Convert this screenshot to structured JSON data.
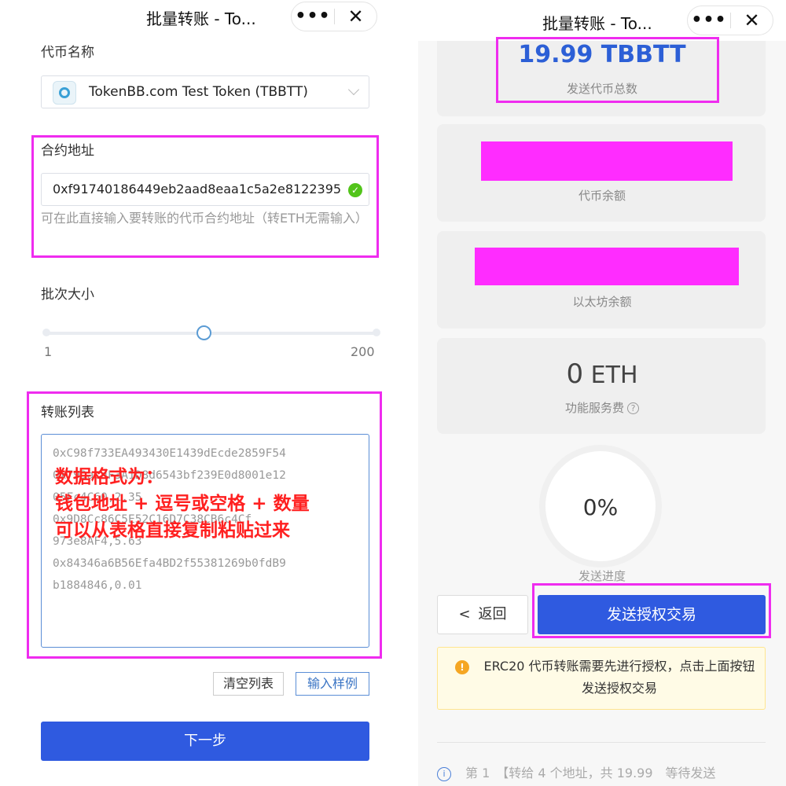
{
  "left": {
    "title": "批量转账 - To...",
    "capsule": {
      "more": "•••",
      "close": "✕"
    },
    "token_name_label": "代币名称",
    "token_select_value": "TokenBB.com Test Token (TBBTT)",
    "contract_label": "合约地址",
    "contract_value": "0xf91740186449eb2aad8eaa1c5a2e8122395",
    "contract_hint": "可在此直接输入要转账的代币合约地址（转ETH无需输入）",
    "batch_label": "批次大小",
    "batch_min": "1",
    "batch_max": "200",
    "batch_value": 100,
    "transfer_list_label": "转账列表",
    "transfer_lines": [
      "0xC98f733EA493430E1439dEcde2859F54",
      "0x79DacdF3A1D8d6543bf239E0d8001e12",
      "05Fc4C60,2.35",
      "0x9D8Cc86C5E52C16D7C38CB6c4Cf",
      "973e8AF4,5.63",
      "0x84346a6B56Efa4BD2f55381269b0fdB9",
      "b1884846,0.01"
    ],
    "overlay_lines": [
      "数据格式为：",
      "钱包地址 + 逗号或空格 + 数量",
      "可以从表格直接复制粘贴过来"
    ],
    "clear_button": "清空列表",
    "sample_button": "输入样例",
    "next_button": "下一步"
  },
  "right": {
    "title": "批量转账 - To...",
    "capsule": {
      "more": "•••",
      "close": "✕"
    },
    "total_amount": "19.99 TBBTT",
    "total_label": "发送代币总数",
    "token_balance_label": "代币余额",
    "eth_balance_label": "以太坊余额",
    "fee_number": "0",
    "fee_unit": "ETH",
    "fee_label": "功能服务费",
    "progress_value": "0%",
    "progress_label": "发送进度",
    "back_button": "返回",
    "send_button": "发送授权交易",
    "warning_text": "ERC20 代币转账需要先进行授权，点击上面按钮发送授权交易",
    "bottom_text": "第 1　【转给 4 个地址，共 19.99　等待发送"
  },
  "colors": {
    "primary": "#2f5ae0",
    "highlight": "#ef2cef",
    "overlay_text": "#ff2020",
    "success": "#52c41a",
    "warning": "#f5a623"
  }
}
